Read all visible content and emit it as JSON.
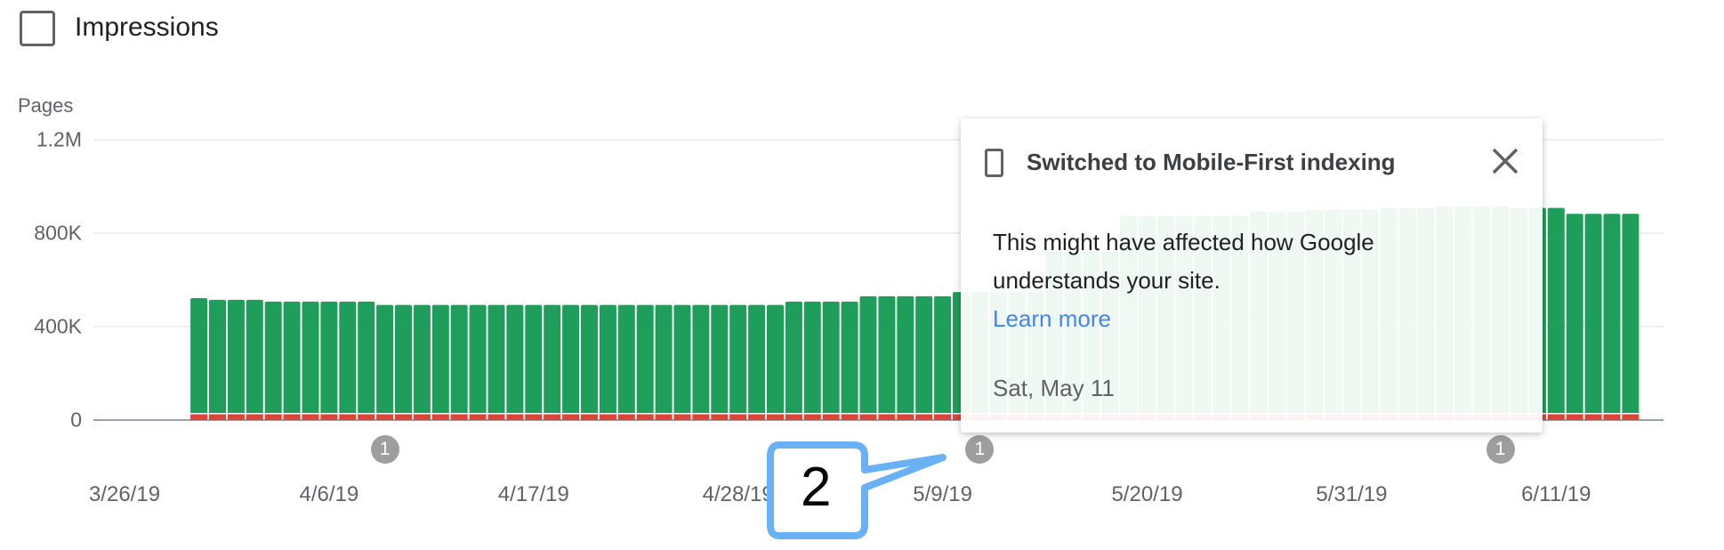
{
  "legend": {
    "checkbox_label": "Impressions",
    "checked": false
  },
  "chart_data": {
    "type": "bar",
    "stacked": true,
    "ylabel": "Pages",
    "ylim": [
      0,
      1200000
    ],
    "yticks": [
      {
        "value": 1200000,
        "label": "1.2M"
      },
      {
        "value": 800000,
        "label": "800K"
      },
      {
        "value": 400000,
        "label": "400K"
      },
      {
        "value": 0,
        "label": "0"
      }
    ],
    "xticks": [
      "3/26/19",
      "4/6/19",
      "4/17/19",
      "4/28/19",
      "5/9/19",
      "5/20/19",
      "5/31/19",
      "6/11/19"
    ],
    "x_start": "2019-03-26",
    "first_bar_date": "2019-03-30",
    "grid": true,
    "colors": {
      "valid": "#1e9e5a",
      "error": "#db4437"
    },
    "series": [
      {
        "key": "valid",
        "values": [
          497000,
          490000,
          490000,
          490000,
          482000,
          482000,
          482000,
          482000,
          482000,
          482000,
          468000,
          468000,
          468000,
          468000,
          468000,
          468000,
          468000,
          468000,
          468000,
          468000,
          468000,
          468000,
          468000,
          468000,
          468000,
          468000,
          468000,
          468000,
          468000,
          468000,
          468000,
          468000,
          482000,
          482000,
          482000,
          482000,
          505000,
          505000,
          505000,
          505000,
          505000,
          523000,
          523000,
          523000,
          523000,
          523000,
          695000,
          695000,
          695000,
          695000,
          849000,
          849000,
          849000,
          849000,
          849000,
          849000,
          849000,
          868000,
          868000,
          868000,
          875000,
          875000,
          875000,
          875000,
          883000,
          883000,
          883000,
          891000,
          891000,
          891000,
          891000,
          883000,
          883000,
          883000,
          858000,
          858000,
          858000,
          858000
        ]
      },
      {
        "key": "error",
        "values": [
          25000,
          25000,
          25000,
          25000,
          25000,
          25000,
          25000,
          25000,
          25000,
          25000,
          25000,
          25000,
          25000,
          25000,
          25000,
          25000,
          25000,
          25000,
          25000,
          25000,
          25000,
          25000,
          25000,
          25000,
          25000,
          25000,
          25000,
          25000,
          25000,
          25000,
          25000,
          25000,
          25000,
          25000,
          25000,
          25000,
          25000,
          25000,
          25000,
          25000,
          25000,
          25000,
          25000,
          25000,
          25000,
          25000,
          25000,
          25000,
          25000,
          25000,
          25000,
          25000,
          25000,
          25000,
          25000,
          25000,
          25000,
          25000,
          25000,
          25000,
          25000,
          25000,
          25000,
          25000,
          25000,
          25000,
          25000,
          25000,
          25000,
          25000,
          25000,
          25000,
          25000,
          25000,
          25000,
          25000,
          25000,
          25000
        ]
      }
    ],
    "annotations": [
      {
        "date": "2019-04-09",
        "label": "1"
      },
      {
        "date": "2019-05-11",
        "label": "1"
      },
      {
        "date": "2019-06-08",
        "label": "1"
      }
    ]
  },
  "tooltip": {
    "icon": "smartphone-icon",
    "title": "Switched to Mobile-First indexing",
    "body": "This might have affected how Google understands your site.",
    "link": "Learn more",
    "link_color": "#4285f4",
    "date": "Sat, May 11"
  },
  "callout": {
    "label": "2",
    "color": "#6ab0f5"
  }
}
